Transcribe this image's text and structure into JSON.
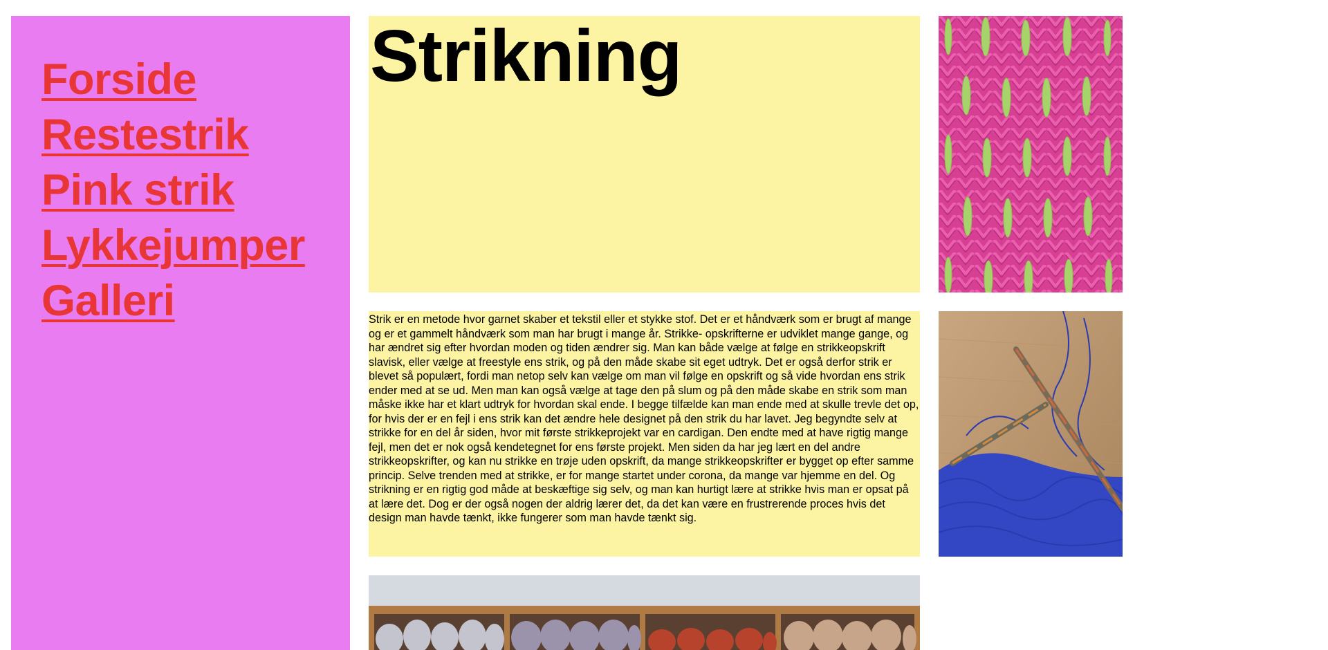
{
  "nav": {
    "items": [
      {
        "label": "Forside"
      },
      {
        "label": "Restestrik"
      },
      {
        "label": "Pink strik"
      },
      {
        "label": "Lykkejumper"
      },
      {
        "label": "Galleri"
      }
    ]
  },
  "header": {
    "title": "Strikning"
  },
  "main": {
    "body_text": "Strik er en metode hvor garnet skaber et tekstil eller et stykke stof. Det er et håndværk som er brugt af mange og er et gammelt håndværk som man har brugt i mange år. Strikke- opskrifterne er udviklet mange gange, og har ændret sig efter hvordan moden og tiden ændrer sig. Man kan både vælge at følge en strikkeopskrift slavisk, eller vælge at freestyle ens strik, og på den måde skabe sit eget udtryk. Det er også derfor strik er blevet så populært, fordi man netop selv kan vælge om man vil følge en opskrift og så vide hvordan ens strik ender med at se ud. Men man kan også vælge at tage den på slum og på den måde skabe en strik som man måske ikke har et klart udtryk for hvordan skal ende. I begge tilfælde kan man ende med at skulle trevle det op, for hvis der er en fejl i ens strik kan det ændre hele designet på den strik du har lavet. Jeg begyndte selv at strikke for en del år siden, hvor mit første strikkeprojekt var en cardigan. Den endte med at have rigtig mange fejl, men det er nok også kendetegnet for ens første projekt. Men siden da har jeg lært en del andre strikkeopskrifter, og kan nu strikke en trøje uden opskrift, da mange strikkeopskrifter er bygget op efter samme princip. Selve trenden med at strikke, er for mange startet under corona, da mange var hjemme en del. Og strikning er en rigtig god måde at beskæftige sig selv, og man kan hurtigt lære at strikke hvis man er opsat på at lære det. Dog er der også nogen der aldrig lærer det, da det kan være en frustrerende proces hvis det design man havde tænkt, ikke fungerer som man havde tænkt sig."
  },
  "colors": {
    "sidebar_bg": "#e87cf0",
    "link": "#e83535",
    "content_bg": "#fcf3a3"
  }
}
